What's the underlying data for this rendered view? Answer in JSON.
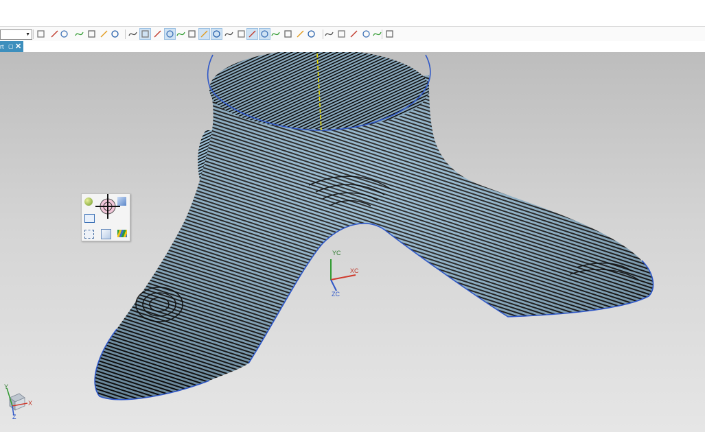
{
  "toolbar": {
    "combo_value": "",
    "icons": [
      "open-icon",
      "part-icon",
      "snap-icon",
      "select-icon",
      "filter-icon",
      "box-select-icon",
      "solid-icon",
      "shaded-cube-icon",
      "feature-point-icon",
      "line-icon",
      "curve-icon",
      "spline-icon",
      "wave-icon",
      "sketch-icon",
      "circle-point-icon",
      "circle-icon",
      "plus-icon",
      "measure-icon",
      "section-icon",
      "layer-icon",
      "display-icon",
      "render-icon",
      "rotate-icon",
      "brush-icon",
      "table-icon",
      "grid-icon",
      "palette-icon",
      "stripes-icon",
      "more-icon"
    ]
  },
  "tab": {
    "label": "rt",
    "pin": "▢",
    "close": "✕"
  },
  "viewport": {
    "wcs": {
      "yc": "YC",
      "xc": "XC",
      "zc": "ZC"
    },
    "triad": {
      "x": "X",
      "y": "Y",
      "z": "Z"
    },
    "colors": {
      "surface": "#8fb6cf",
      "stripe": "#0d0d0d",
      "edge": "#2e57c8",
      "background": "#c9c9c9"
    }
  },
  "radial_menu": {
    "icons": [
      "sphere-icon",
      "crosshair-icon",
      "cube-icon",
      "window-icon",
      "fit-icon",
      "box-icon",
      "stripes-icon"
    ]
  }
}
